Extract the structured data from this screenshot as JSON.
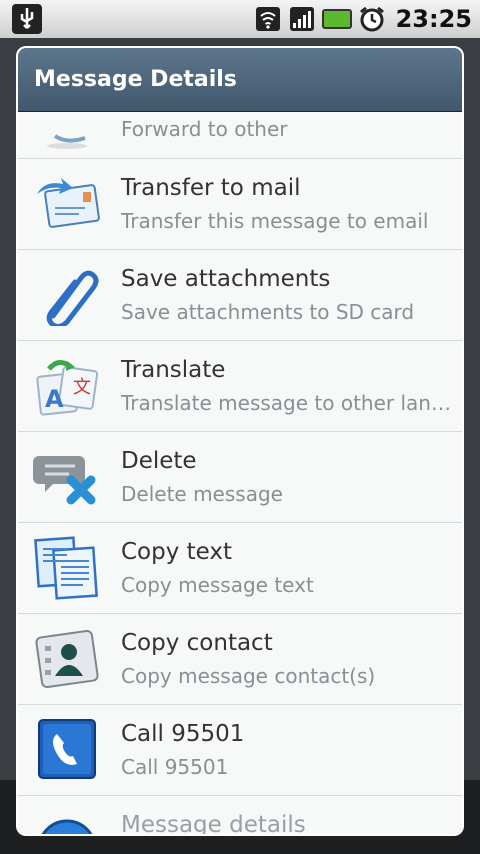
{
  "status_bar": {
    "time": "23:25",
    "icons": [
      "usb-icon",
      "wifi-icon",
      "signal-icon",
      "battery-icon",
      "alarm-icon"
    ]
  },
  "dialog": {
    "title": "Message Details",
    "items": [
      {
        "title": "",
        "subtitle": "Forward to other",
        "icon": "forward-icon"
      },
      {
        "title": "Transfer to mail",
        "subtitle": "Transfer this message to email",
        "icon": "mail-transfer-icon"
      },
      {
        "title": "Save attachments",
        "subtitle": "Save attachments to SD card",
        "icon": "paperclip-icon"
      },
      {
        "title": "Translate",
        "subtitle": "Translate message to other langu...",
        "icon": "translate-icon"
      },
      {
        "title": "Delete",
        "subtitle": "Delete message",
        "icon": "delete-message-icon"
      },
      {
        "title": "Copy text",
        "subtitle": "Copy message text",
        "icon": "copy-text-icon"
      },
      {
        "title": "Copy contact",
        "subtitle": "Copy message contact(s)",
        "icon": "contact-card-icon"
      },
      {
        "title": "Call 95501",
        "subtitle": "Call 95501",
        "icon": "phone-icon"
      },
      {
        "title": "Message details",
        "subtitle": "",
        "icon": "info-icon"
      }
    ]
  }
}
